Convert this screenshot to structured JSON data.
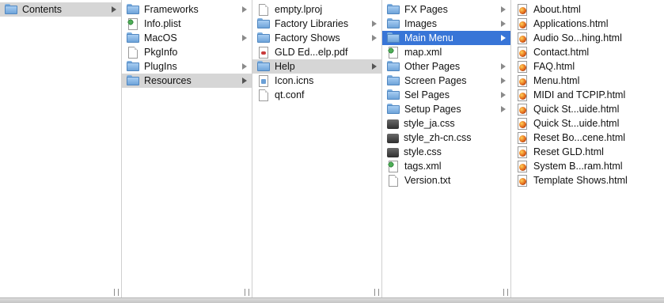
{
  "columns": [
    {
      "items": [
        {
          "label": "Contents",
          "icon": "folder",
          "arrow": true,
          "selected": "gray"
        }
      ]
    },
    {
      "items": [
        {
          "label": "Frameworks",
          "icon": "folder",
          "arrow": true
        },
        {
          "label": "Info.plist",
          "icon": "plist",
          "arrow": false
        },
        {
          "label": "MacOS",
          "icon": "folder",
          "arrow": true
        },
        {
          "label": "PkgInfo",
          "icon": "doc",
          "arrow": false
        },
        {
          "label": "PlugIns",
          "icon": "folder",
          "arrow": true
        },
        {
          "label": "Resources",
          "icon": "folder",
          "arrow": true,
          "selected": "gray"
        }
      ]
    },
    {
      "items": [
        {
          "label": "empty.lproj",
          "icon": "doc",
          "arrow": false
        },
        {
          "label": "Factory Libraries",
          "icon": "folder",
          "arrow": true
        },
        {
          "label": "Factory Shows",
          "icon": "folder",
          "arrow": true
        },
        {
          "label": "GLD Ed...elp.pdf",
          "icon": "pdf",
          "arrow": false
        },
        {
          "label": "Help",
          "icon": "folder",
          "arrow": true,
          "selected": "gray"
        },
        {
          "label": "Icon.icns",
          "icon": "icns",
          "arrow": false
        },
        {
          "label": "qt.conf",
          "icon": "doc",
          "arrow": false
        }
      ]
    },
    {
      "items": [
        {
          "label": "FX Pages",
          "icon": "folder",
          "arrow": true
        },
        {
          "label": "Images",
          "icon": "folder",
          "arrow": true
        },
        {
          "label": "Main Menu",
          "icon": "folder",
          "arrow": true,
          "selected": "blue"
        },
        {
          "label": "map.xml",
          "icon": "plist",
          "arrow": false
        },
        {
          "label": "Other Pages",
          "icon": "folder",
          "arrow": true
        },
        {
          "label": "Screen Pages",
          "icon": "folder",
          "arrow": true
        },
        {
          "label": "Sel Pages",
          "icon": "folder",
          "arrow": true
        },
        {
          "label": "Setup Pages",
          "icon": "folder",
          "arrow": true
        },
        {
          "label": "style_ja.css",
          "icon": "css",
          "arrow": false
        },
        {
          "label": "style_zh-cn.css",
          "icon": "css",
          "arrow": false
        },
        {
          "label": "style.css",
          "icon": "css",
          "arrow": false
        },
        {
          "label": "tags.xml",
          "icon": "plist",
          "arrow": false
        },
        {
          "label": "Version.txt",
          "icon": "doc",
          "arrow": false
        }
      ]
    },
    {
      "items": [
        {
          "label": "About.html",
          "icon": "html",
          "arrow": false
        },
        {
          "label": "Applications.html",
          "icon": "html",
          "arrow": false
        },
        {
          "label": "Audio So...hing.html",
          "icon": "html",
          "arrow": false
        },
        {
          "label": "Contact.html",
          "icon": "html",
          "arrow": false
        },
        {
          "label": "FAQ.html",
          "icon": "html",
          "arrow": false
        },
        {
          "label": "Menu.html",
          "icon": "html",
          "arrow": false
        },
        {
          "label": "MIDI and TCPIP.html",
          "icon": "html",
          "arrow": false
        },
        {
          "label": "Quick St...uide.html",
          "icon": "html",
          "arrow": false
        },
        {
          "label": "Quick St...uide.html",
          "icon": "html",
          "arrow": false
        },
        {
          "label": "Reset Bo...cene.html",
          "icon": "html",
          "arrow": false
        },
        {
          "label": "Reset GLD.html",
          "icon": "html",
          "arrow": false
        },
        {
          "label": "System B...ram.html",
          "icon": "html",
          "arrow": false
        },
        {
          "label": "Template Shows.html",
          "icon": "html",
          "arrow": false
        }
      ]
    }
  ],
  "colors": {
    "selection_blue": "#3875d7",
    "selection_gray": "#d6d6d6"
  }
}
